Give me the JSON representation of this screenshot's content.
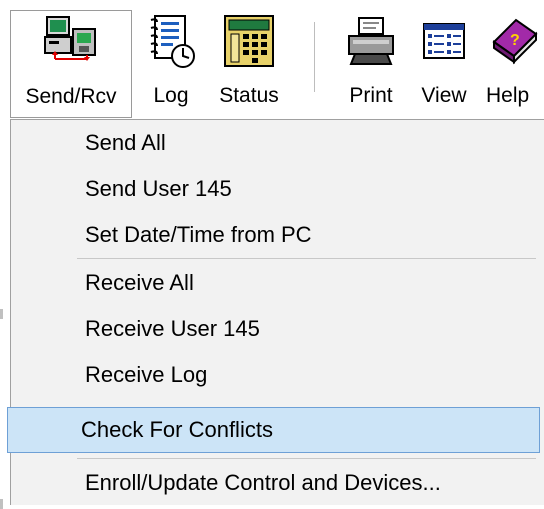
{
  "toolbar": {
    "buttons": [
      {
        "label": "Send/Rcv",
        "icon": "send-receive-icon"
      },
      {
        "label": "Log",
        "icon": "log-icon"
      },
      {
        "label": "Status",
        "icon": "status-icon"
      },
      {
        "label": "Print",
        "icon": "printer-icon"
      },
      {
        "label": "View",
        "icon": "view-icon"
      },
      {
        "label": "Help",
        "icon": "help-book-icon"
      }
    ]
  },
  "menu": {
    "items": [
      {
        "label": "Send All"
      },
      {
        "label": "Send User 145"
      },
      {
        "label": "Set Date/Time from PC"
      },
      {
        "label": "Receive All"
      },
      {
        "label": "Receive User 145"
      },
      {
        "label": "Receive Log"
      },
      {
        "label": "Check For Conflicts",
        "highlighted": true
      },
      {
        "label": "Enroll/Update Control and Devices..."
      }
    ]
  },
  "colors": {
    "menu_background": "#f2f2f2",
    "highlight_background": "#cce4f7",
    "highlight_border": "#6ea0d6"
  }
}
